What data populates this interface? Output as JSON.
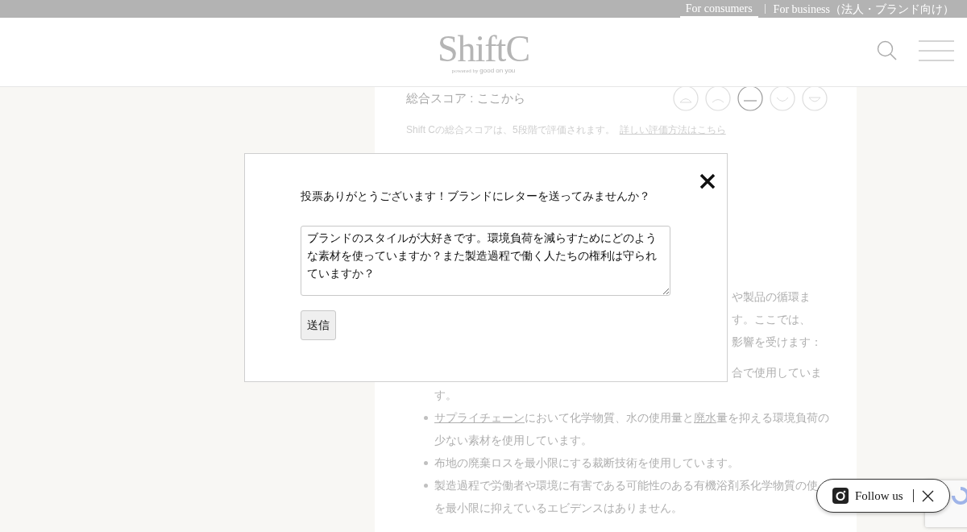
{
  "top_bar": {
    "links": [
      {
        "label": "For consumers",
        "selected": true
      },
      {
        "label": "For business（法人・ブランド向け）",
        "selected": false
      }
    ]
  },
  "header": {
    "logo": "ShiftC",
    "tagline_prefix": "powered by",
    "tagline_brand": "good on you"
  },
  "score": {
    "label": "総合スコア : ここから",
    "faces": [
      {
        "kind": "very-sad",
        "selected": false
      },
      {
        "kind": "sad",
        "selected": false
      },
      {
        "kind": "neutral",
        "selected": true
      },
      {
        "kind": "happy",
        "selected": false
      },
      {
        "kind": "very-happy",
        "selected": false
      }
    ],
    "note": "Shift Cの総合スコアは、5段階で評価されます。",
    "note_link": "詳しい評価方法はこちら"
  },
  "body_lines": [
    "や製品の循環ま",
    "す。ここでは、",
    "影響を受けます："
  ],
  "bullets": [
    {
      "segments": [
        {
          "text": "合で使用していま",
          "link": false
        }
      ],
      "continuation": "す。"
    },
    {
      "segments": [
        {
          "text": "サプライチェーン",
          "link": true
        },
        {
          "text": "において化学物質、水の使用量と",
          "link": false
        },
        {
          "text": "廃水",
          "link": true
        },
        {
          "text": "量を抑える環境負荷の少ない素材を使用しています。",
          "link": false
        }
      ]
    },
    {
      "segments": [
        {
          "text": "布地の廃棄ロスを最小限にする裁断技術を使用しています。",
          "link": false
        }
      ]
    },
    {
      "segments": [
        {
          "text": "製造過程で労働者や環境に有害である可能性のある有機浴剤系化学物質の使",
          "link": false
        }
      ],
      "continuation": "を最小限に抑えているエビデンスはありません。"
    }
  ],
  "modal": {
    "title": "投票ありがとうございます！ブランドにレターを送ってみませんか？",
    "letter": "ブランドのスタイルが大好きです。環境負荷を減らすためにどのような素材を使っていますか？また製造過程で働く人たちの権利は守られていますか？",
    "submit": "送信"
  },
  "follow": {
    "label": "Follow us"
  }
}
